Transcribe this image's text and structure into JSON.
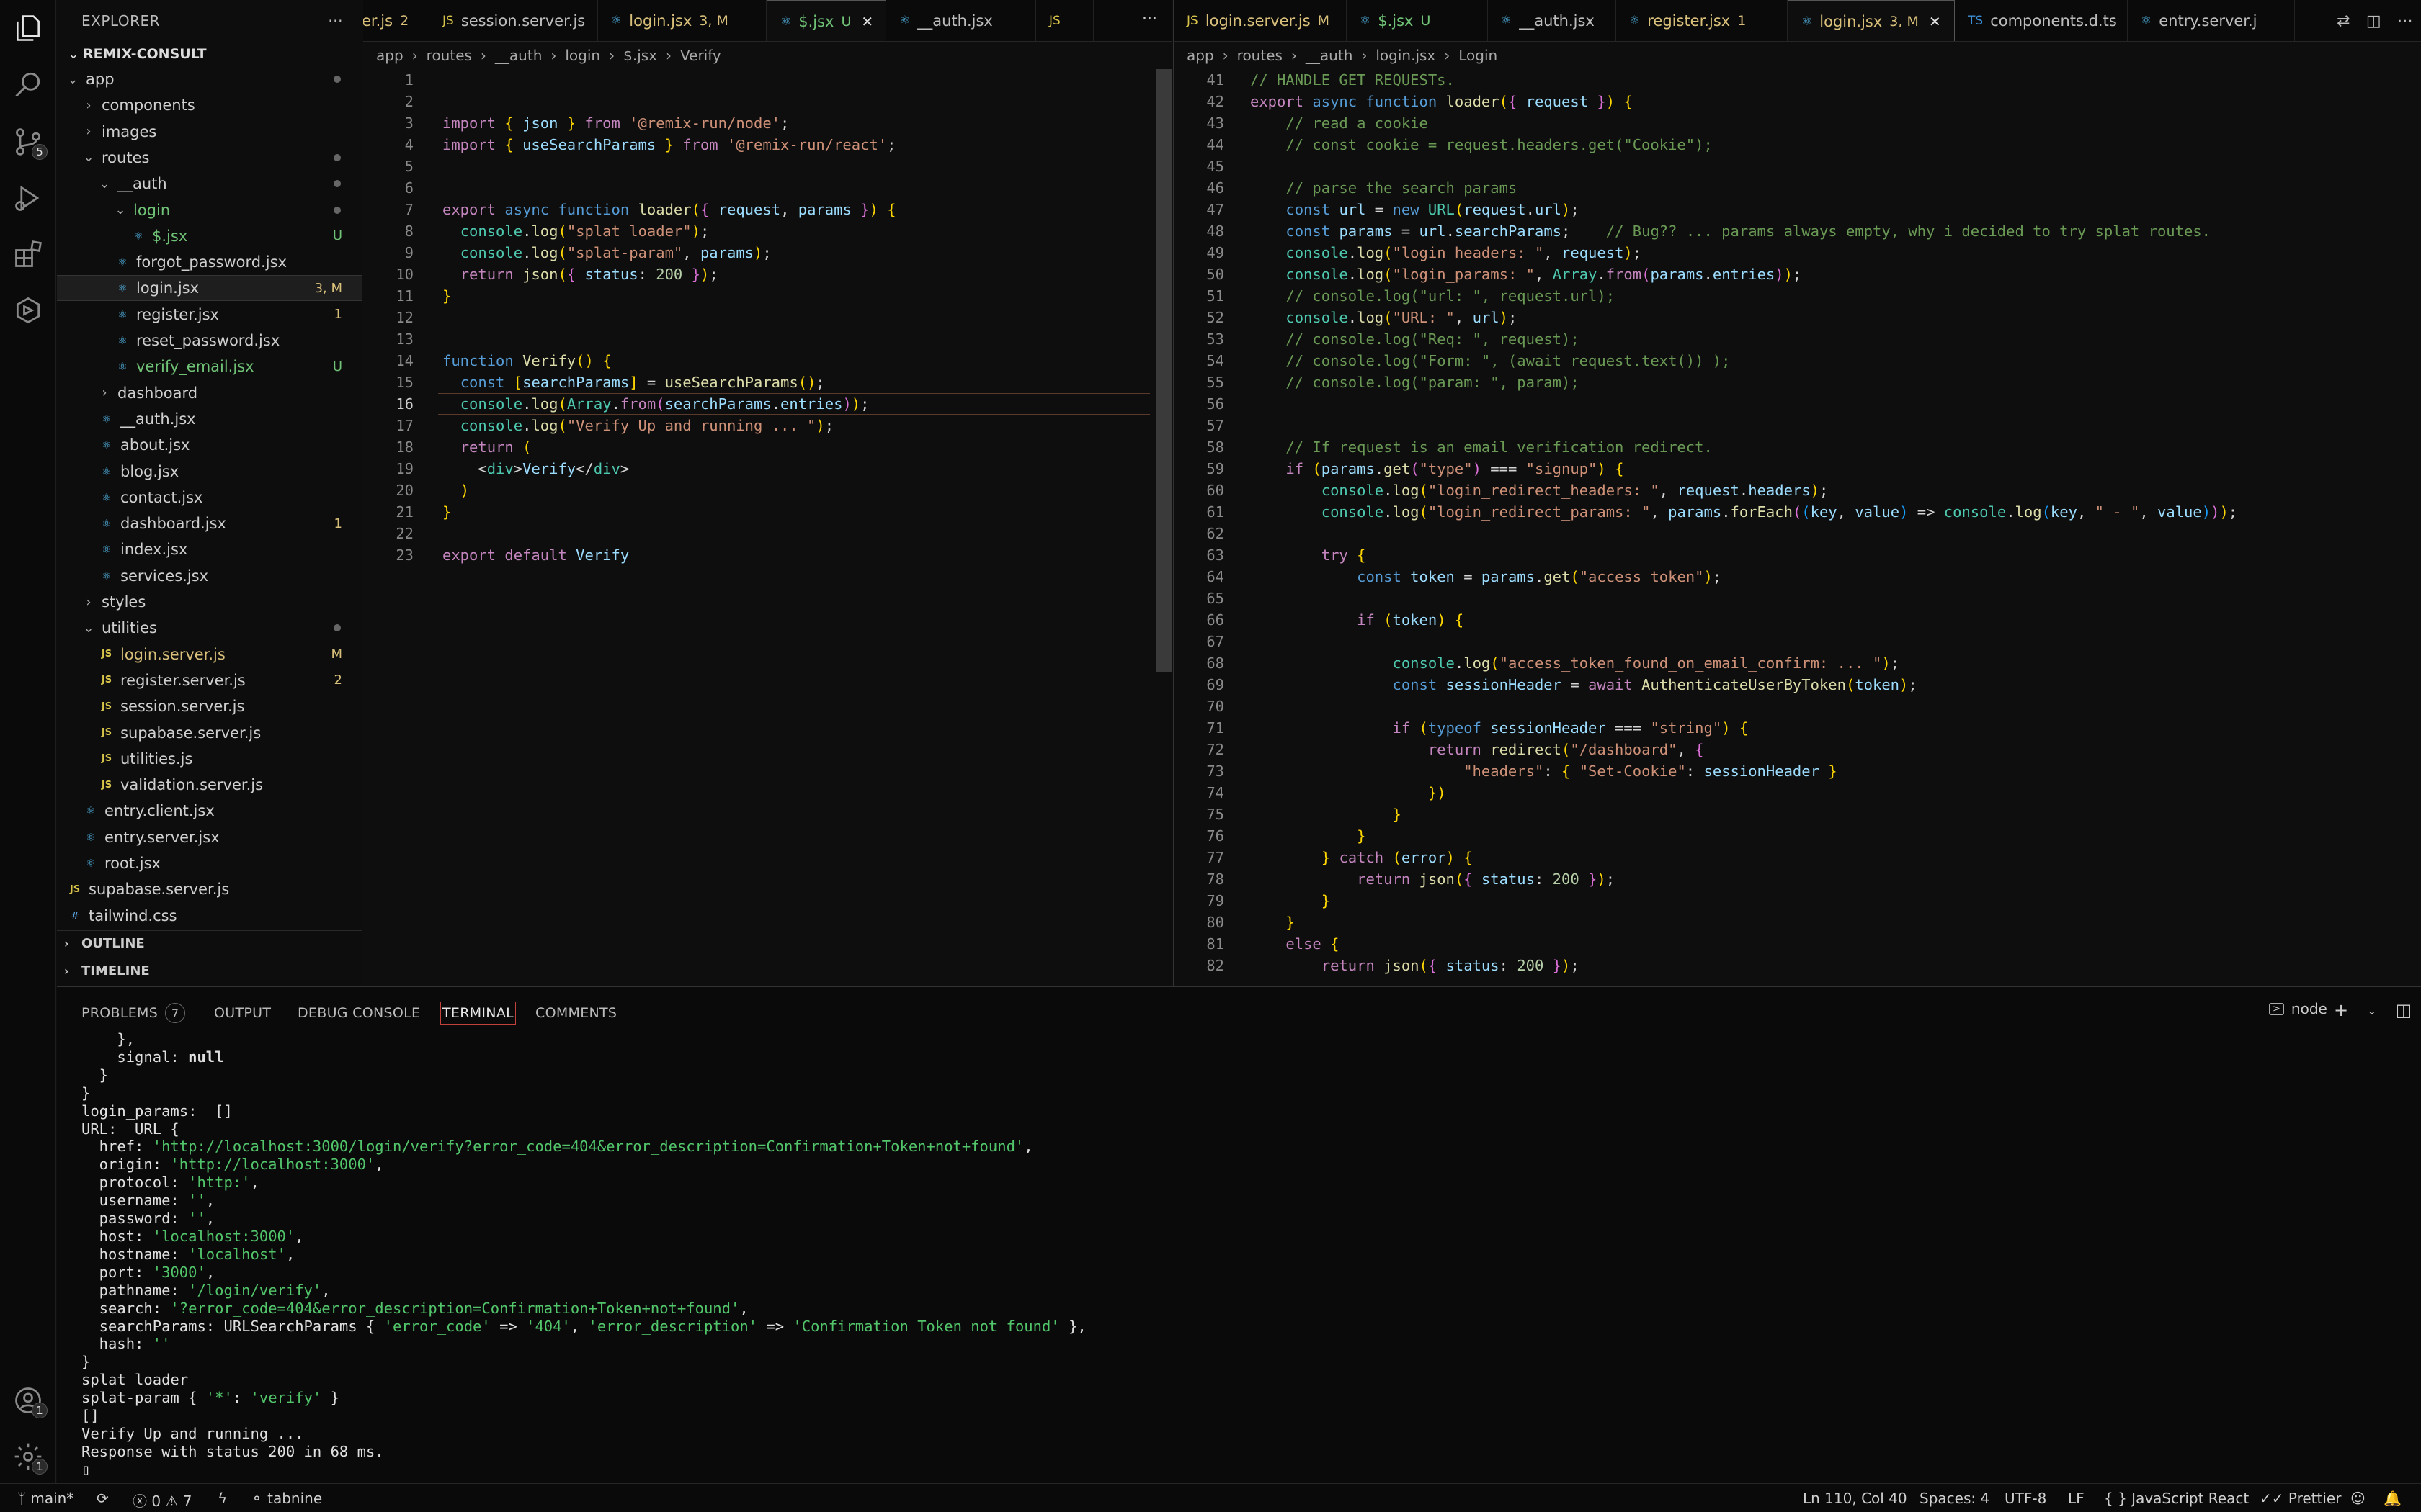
{
  "activity_bar": {
    "scm_badge": "5",
    "account_badge": "1",
    "settings_badge": "1"
  },
  "sidebar": {
    "title": "EXPLORER",
    "more": "···",
    "project": "REMIX-CONSULT",
    "items": [
      {
        "label": "app",
        "kind": "folder-open",
        "depth": 1,
        "status": "dot"
      },
      {
        "label": "components",
        "kind": "folder",
        "depth": 2
      },
      {
        "label": "images",
        "kind": "folder",
        "depth": 2
      },
      {
        "label": "routes",
        "kind": "folder-open",
        "depth": 2,
        "status": "dot"
      },
      {
        "label": "__auth",
        "kind": "folder-open",
        "depth": 3,
        "status": "dot"
      },
      {
        "label": "login",
        "kind": "folder-open",
        "depth": 4,
        "status": "dot",
        "color": "green"
      },
      {
        "label": "$.jsx",
        "kind": "react",
        "depth": 5,
        "status": "U",
        "color": "green"
      },
      {
        "label": "forgot_password.jsx",
        "kind": "react",
        "depth": 4
      },
      {
        "label": "login.jsx",
        "kind": "react",
        "depth": 4,
        "status": "3, M",
        "selected": true
      },
      {
        "label": "register.jsx",
        "kind": "react",
        "depth": 4,
        "status": "1"
      },
      {
        "label": "reset_password.jsx",
        "kind": "react",
        "depth": 4
      },
      {
        "label": "verify_email.jsx",
        "kind": "react",
        "depth": 4,
        "status": "U",
        "color": "green"
      },
      {
        "label": "dashboard",
        "kind": "folder",
        "depth": 3
      },
      {
        "label": "__auth.jsx",
        "kind": "react",
        "depth": 3
      },
      {
        "label": "about.jsx",
        "kind": "react",
        "depth": 3
      },
      {
        "label": "blog.jsx",
        "kind": "react",
        "depth": 3
      },
      {
        "label": "contact.jsx",
        "kind": "react",
        "depth": 3
      },
      {
        "label": "dashboard.jsx",
        "kind": "react",
        "depth": 3,
        "status": "1"
      },
      {
        "label": "index.jsx",
        "kind": "react",
        "depth": 3
      },
      {
        "label": "services.jsx",
        "kind": "react",
        "depth": 3
      },
      {
        "label": "styles",
        "kind": "folder",
        "depth": 2
      },
      {
        "label": "utilities",
        "kind": "folder-open",
        "depth": 2,
        "status": "dot"
      },
      {
        "label": "login.server.js",
        "kind": "js",
        "depth": 3,
        "status": "M",
        "color": "yellow"
      },
      {
        "label": "register.server.js",
        "kind": "js",
        "depth": 3,
        "status": "2"
      },
      {
        "label": "session.server.js",
        "kind": "js",
        "depth": 3
      },
      {
        "label": "supabase.server.js",
        "kind": "js",
        "depth": 3
      },
      {
        "label": "utilities.js",
        "kind": "js",
        "depth": 3
      },
      {
        "label": "validation.server.js",
        "kind": "js",
        "depth": 3
      },
      {
        "label": "entry.client.jsx",
        "kind": "react",
        "depth": 2
      },
      {
        "label": "entry.server.jsx",
        "kind": "react",
        "depth": 2
      },
      {
        "label": "root.jsx",
        "kind": "react",
        "depth": 2
      },
      {
        "label": "supabase.server.js",
        "kind": "js",
        "depth": 1
      },
      {
        "label": "tailwind.css",
        "kind": "css",
        "depth": 1
      }
    ],
    "outline": "OUTLINE",
    "timeline": "TIMELINE"
  },
  "left_editor": {
    "tabs": [
      {
        "label": "er.js",
        "icon": "",
        "status": "2"
      },
      {
        "label": "session.server.js",
        "icon": "JS",
        "status": ""
      },
      {
        "label": "login.jsx",
        "icon": "⚛",
        "status": "3, M"
      },
      {
        "label": "$.jsx",
        "icon": "⚛",
        "status": "U",
        "active": true,
        "close": "✕"
      },
      {
        "label": "__auth.jsx",
        "icon": "⚛",
        "status": ""
      },
      {
        "label": "",
        "icon": "JS",
        "status": ""
      }
    ],
    "tabs_more": "···",
    "breadcrumb": [
      "app",
      "routes",
      "__auth",
      "login",
      "$.jsx",
      "Verify"
    ],
    "current_line": "16",
    "lines": [
      "",
      "",
      "import { json } from '@remix-run/node';",
      "import { useSearchParams } from '@remix-run/react';",
      "",
      "",
      "export async function loader({ request, params }) {",
      "  console.log(\"splat loader\");",
      "  console.log(\"splat-param\", params);",
      "  return json({ status: 200 });",
      "}",
      "",
      "",
      "function Verify() {",
      "  const [searchParams] = useSearchParams();",
      "  console.log(Array.from(searchParams.entries));",
      "  console.log(\"Verify Up and running ... \");",
      "  return (",
      "    <div>Verify</div>",
      "  )",
      "}",
      "",
      "export default Verify"
    ]
  },
  "right_editor": {
    "tabs": [
      {
        "label": "login.server.js",
        "icon": "JS",
        "status": "M"
      },
      {
        "label": "$.jsx",
        "icon": "⚛",
        "status": "U"
      },
      {
        "label": "__auth.jsx",
        "icon": "⚛",
        "status": ""
      },
      {
        "label": "register.jsx",
        "icon": "⚛",
        "status": "1"
      },
      {
        "label": "login.jsx",
        "icon": "⚛",
        "status": "3, M",
        "active": true,
        "close": "✕"
      },
      {
        "label": "components.d.ts",
        "icon": "TS",
        "status": ""
      },
      {
        "label": "entry.server.j",
        "icon": "⚛",
        "status": ""
      }
    ],
    "breadcrumb": [
      "app",
      "routes",
      "__auth",
      "login.jsx",
      "Login"
    ],
    "first_line": 41,
    "lines": [
      "// HANDLE GET REQUESTs.",
      "export async function loader({ request }) {",
      "    // read a cookie",
      "    // const cookie = request.headers.get(\"Cookie\");",
      "",
      "    // parse the search params",
      "    const url = new URL(request.url);",
      "    const params = url.searchParams;    // Bug?? ... params always empty, why i decided to try splat routes.",
      "    console.log(\"login_headers: \", request);",
      "    console.log(\"login_params: \", Array.from(params.entries));",
      "    // console.log(\"url: \", request.url);",
      "    console.log(\"URL: \", url);",
      "    // console.log(\"Req: \", request);",
      "    // console.log(\"Form: \", (await request.text()) );",
      "    // console.log(\"param: \", param);",
      "",
      "",
      "    // If request is an email verification redirect.",
      "    if (params.get(\"type\") === \"signup\") {",
      "        console.log(\"login_redirect_headers: \", request.headers);",
      "        console.log(\"login_redirect_params: \", params.forEach((key, value) => console.log(key, \" - \", value)));",
      "",
      "        try {",
      "            const token = params.get(\"access_token\");",
      "",
      "            if (token) {",
      "",
      "                console.log(\"access_token_found_on_email_confirm: ... \");",
      "                const sessionHeader = await AuthenticateUserByToken(token);",
      "",
      "                if (typeof sessionHeader === \"string\") {",
      "                    return redirect(\"/dashboard\", {",
      "                        \"headers\": { \"Set-Cookie\": sessionHeader }",
      "                    })",
      "                }",
      "            }",
      "        } catch (error) {",
      "            return json({ status: 200 });",
      "        }",
      "    }",
      "    else {",
      "        return json({ status: 200 });"
    ]
  },
  "panel": {
    "tabs": [
      "PROBLEMS",
      "OUTPUT",
      "DEBUG CONSOLE",
      "TERMINAL",
      "COMMENTS"
    ],
    "problems_count": "7",
    "active_tab": "TERMINAL",
    "shell": "node",
    "terminal_lines": [
      "    },",
      "    signal: null",
      "  }",
      "}",
      "login_params:  []",
      "URL:  URL {",
      "  href: 'http://localhost:3000/login/verify?error_code=404&error_description=Confirmation+Token+not+found',",
      "  origin: 'http://localhost:3000',",
      "  protocol: 'http:',",
      "  username: '',",
      "  password: '',",
      "  host: 'localhost:3000',",
      "  hostname: 'localhost',",
      "  port: '3000',",
      "  pathname: '/login/verify',",
      "  search: '?error_code=404&error_description=Confirmation+Token+not+found',",
      "  searchParams: URLSearchParams { 'error_code' => '404', 'error_description' => 'Confirmation Token not found' },",
      "  hash: ''",
      "}",
      "splat loader",
      "splat-param { '*': 'verify' }",
      "[]",
      "Verify Up and running ...",
      "Response with status 200 in 68 ms.",
      "▯"
    ]
  },
  "status_bar": {
    "branch": "main*",
    "errors": "0",
    "warnings": "7",
    "tabnine": "tabnine",
    "position": "Ln 110, Col 40",
    "spaces": "Spaces: 4",
    "encoding": "UTF-8",
    "eol": "LF",
    "language": "JavaScript React",
    "formatter": "Prettier"
  }
}
